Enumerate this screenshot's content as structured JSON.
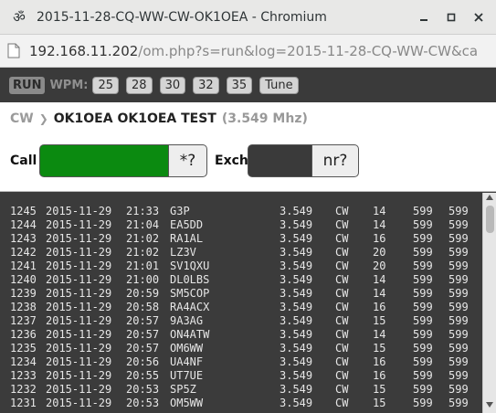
{
  "window": {
    "app_icon": "om-symbol",
    "app_icon_glyph": "ॐ",
    "title": "2015-11-28-CQ-WW-CW-OK1OEA - Chromium"
  },
  "browser": {
    "doc_icon": "document-icon",
    "url_host": "192.168.11.202",
    "url_rest": "/om.php?s=run&log=2015-11-28-CQ-WW-CW&ca"
  },
  "toolbar": {
    "run_label": "RUN",
    "wpm_label": "WPM:",
    "wpm_options": [
      "25",
      "28",
      "30",
      "32",
      "35"
    ],
    "tune_label": "Tune"
  },
  "header": {
    "mode": "CW",
    "separator": "❯",
    "title": "OK1OEA OK1OEA TEST",
    "frequency": "(3.549 Mhz)"
  },
  "entry": {
    "call_label": "Call",
    "call_value": "",
    "call_suffix": "*?",
    "exch_label": "Exch",
    "exch_value": "",
    "exch_suffix": "nr?"
  },
  "log_rows": [
    {
      "nr": "1245",
      "date": "2015-11-29",
      "time": "21:33",
      "call": "G3P",
      "freq": "3.549",
      "mode": "CW",
      "rst": "14",
      "s": "599",
      "r": "599"
    },
    {
      "nr": "1244",
      "date": "2015-11-29",
      "time": "21:04",
      "call": "EA5DD",
      "freq": "3.549",
      "mode": "CW",
      "rst": "14",
      "s": "599",
      "r": "599"
    },
    {
      "nr": "1243",
      "date": "2015-11-29",
      "time": "21:02",
      "call": "RA1AL",
      "freq": "3.549",
      "mode": "CW",
      "rst": "16",
      "s": "599",
      "r": "599"
    },
    {
      "nr": "1242",
      "date": "2015-11-29",
      "time": "21:02",
      "call": "LZ3V",
      "freq": "3.549",
      "mode": "CW",
      "rst": "20",
      "s": "599",
      "r": "599"
    },
    {
      "nr": "1241",
      "date": "2015-11-29",
      "time": "21:01",
      "call": "SV1QXU",
      "freq": "3.549",
      "mode": "CW",
      "rst": "20",
      "s": "599",
      "r": "599"
    },
    {
      "nr": "1240",
      "date": "2015-11-29",
      "time": "21:00",
      "call": "DL0LBS",
      "freq": "3.549",
      "mode": "CW",
      "rst": "14",
      "s": "599",
      "r": "599"
    },
    {
      "nr": "1239",
      "date": "2015-11-29",
      "time": "20:59",
      "call": "SM5COP",
      "freq": "3.549",
      "mode": "CW",
      "rst": "14",
      "s": "599",
      "r": "599"
    },
    {
      "nr": "1238",
      "date": "2015-11-29",
      "time": "20:58",
      "call": "RA4ACX",
      "freq": "3.549",
      "mode": "CW",
      "rst": "16",
      "s": "599",
      "r": "599"
    },
    {
      "nr": "1237",
      "date": "2015-11-29",
      "time": "20:57",
      "call": "9A3AG",
      "freq": "3.549",
      "mode": "CW",
      "rst": "15",
      "s": "599",
      "r": "599"
    },
    {
      "nr": "1236",
      "date": "2015-11-29",
      "time": "20:57",
      "call": "ON4ATW",
      "freq": "3.549",
      "mode": "CW",
      "rst": "14",
      "s": "599",
      "r": "599"
    },
    {
      "nr": "1235",
      "date": "2015-11-29",
      "time": "20:57",
      "call": "OM6WW",
      "freq": "3.549",
      "mode": "CW",
      "rst": "15",
      "s": "599",
      "r": "599"
    },
    {
      "nr": "1234",
      "date": "2015-11-29",
      "time": "20:56",
      "call": "UA4NF",
      "freq": "3.549",
      "mode": "CW",
      "rst": "16",
      "s": "599",
      "r": "599"
    },
    {
      "nr": "1233",
      "date": "2015-11-29",
      "time": "20:55",
      "call": "UT7UE",
      "freq": "3.549",
      "mode": "CW",
      "rst": "16",
      "s": "599",
      "r": "599"
    },
    {
      "nr": "1232",
      "date": "2015-11-29",
      "time": "20:53",
      "call": "SP5Z",
      "freq": "3.549",
      "mode": "CW",
      "rst": "15",
      "s": "599",
      "r": "599"
    },
    {
      "nr": "1231",
      "date": "2015-11-29",
      "time": "20:53",
      "call": "OM5WW",
      "freq": "3.549",
      "mode": "CW",
      "rst": "15",
      "s": "599",
      "r": "599"
    }
  ],
  "colors": {
    "call_field": "#0b8a10",
    "exch_field": "#3a3a3a",
    "log_background": "#3b3b3b"
  }
}
